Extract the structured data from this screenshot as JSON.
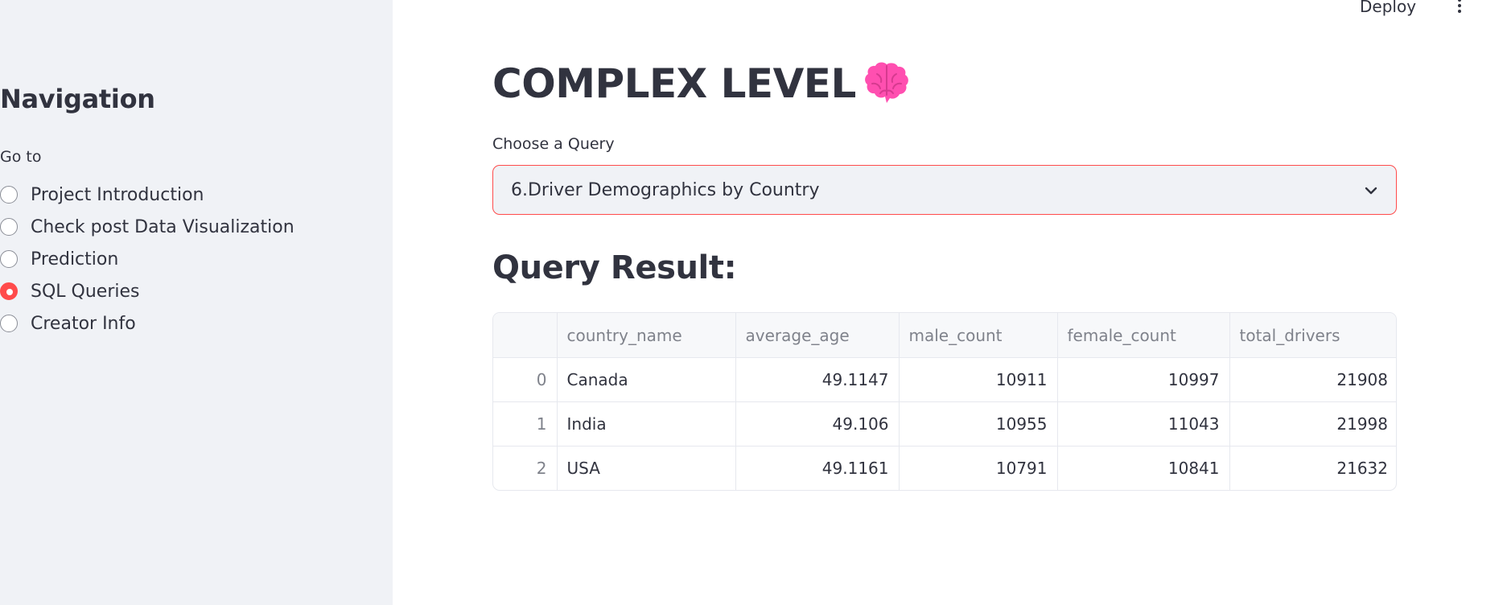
{
  "header": {
    "deploy_label": "Deploy",
    "menu_icon": "more-vertical-icon"
  },
  "sidebar": {
    "title": "Navigation",
    "goto_label": "Go to",
    "selected": "SQL Queries",
    "items": [
      {
        "label": "Project Introduction",
        "selected": false
      },
      {
        "label": "Check post Data Visualization",
        "selected": false
      },
      {
        "label": "Prediction",
        "selected": false
      },
      {
        "label": "SQL Queries",
        "selected": true
      },
      {
        "label": "Creator Info",
        "selected": false
      }
    ]
  },
  "main": {
    "title": "COMPLEX LEVEL",
    "title_icon": "brain-icon",
    "select_label": "Choose a Query",
    "select_value": "6.Driver Demographics by Country",
    "result_heading": "Query Result:",
    "table": {
      "columns": [
        "",
        "country_name",
        "average_age",
        "male_count",
        "female_count",
        "total_drivers"
      ],
      "rows": [
        [
          "0",
          "Canada",
          "49.1147",
          "10911",
          "10997",
          "21908"
        ],
        [
          "1",
          "India",
          "49.106",
          "10955",
          "11043",
          "21998"
        ],
        [
          "2",
          "USA",
          "49.1161",
          "10791",
          "10841",
          "21632"
        ]
      ]
    }
  },
  "colors": {
    "accent": "#ff4b4b",
    "sidebar_bg": "#f0f2f6",
    "text": "#31333f",
    "muted_text": "#7f828b",
    "title_icon": "#ff4fb0"
  }
}
